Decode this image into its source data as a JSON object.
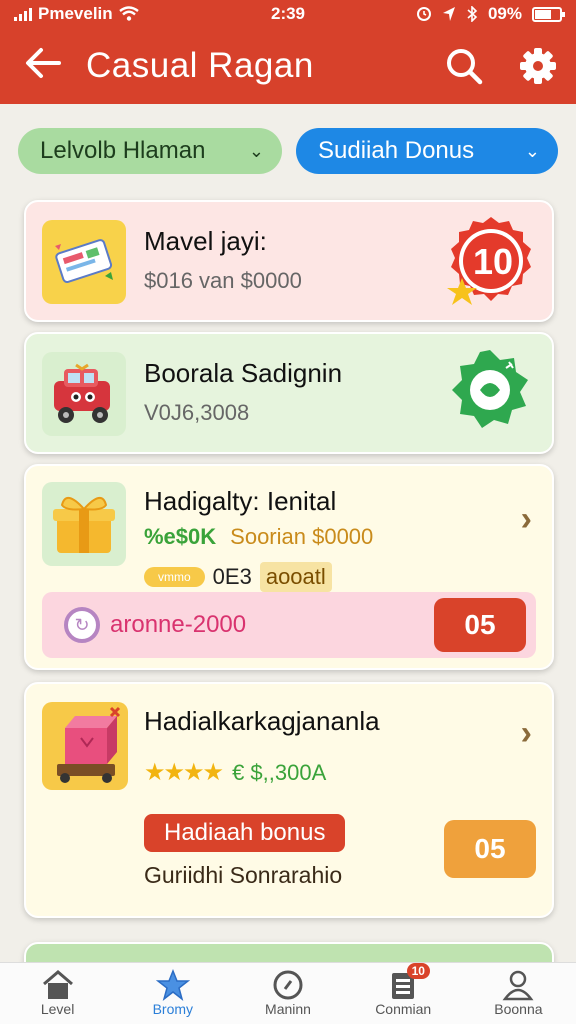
{
  "status_bar": {
    "carrier": "Pmevelin",
    "time": "2:39",
    "battery": "09%"
  },
  "app_bar": {
    "title": "Casual Ragan"
  },
  "filters": [
    {
      "label": "Lelvolb Hlaman",
      "color": "#a9dba0"
    },
    {
      "label": "Sudiiah Donus",
      "color": "#1e88e5"
    }
  ],
  "cards": [
    {
      "name": "Mavel jayi:",
      "subtitle": "$016 van $0000",
      "badge": "10"
    },
    {
      "name": "Boorala Sadignin",
      "subtitle": "V0J6,3008"
    },
    {
      "name": "Hadigalty: Ienital",
      "tag_green": "%e$0K",
      "tag_orange": "Soorian $0000",
      "pill_label": "vmmo",
      "pill_text": "0E3",
      "pill_sand": "aooatl",
      "bar_text": "aronne-2000",
      "count": "05"
    },
    {
      "name": "Hadialkarkagjananla",
      "stars": "★★★★",
      "value": "€ $,,300A",
      "button_label": "Hadiaah bonus",
      "count": "05",
      "footnote": "Guriidhi Sonrarahio"
    }
  ],
  "tabs": [
    {
      "label": "Level",
      "icon": "home-icon"
    },
    {
      "label": "Bromy",
      "icon": "star-icon",
      "active": true
    },
    {
      "label": "Maninn",
      "icon": "clock-icon"
    },
    {
      "label": "Conmian",
      "icon": "document-icon",
      "badge": "10"
    },
    {
      "label": "Boonna",
      "icon": "person-icon"
    }
  ],
  "colors": {
    "primary": "#d7412b",
    "accent_blue": "#1e88e5",
    "green": "#3aa33a",
    "orange": "#efa13c"
  }
}
